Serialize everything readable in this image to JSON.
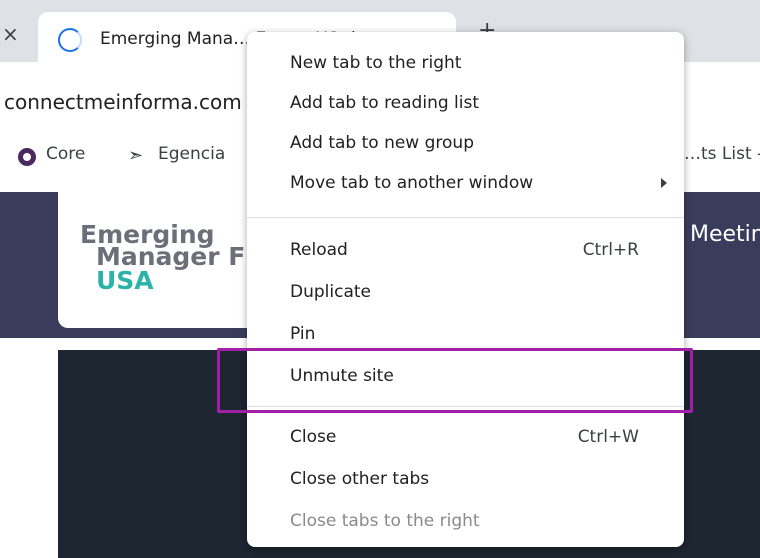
{
  "browser": {
    "tab": {
      "title": "Emerging Mana… EuropeUS.riv…"
    },
    "url": "connectmeinforma.com",
    "bookmarks": [
      {
        "label": "Core"
      },
      {
        "label": "Egencia"
      },
      {
        "label": "…ts List -…"
      }
    ]
  },
  "page": {
    "logo": {
      "line1": "Emerging",
      "line2": "Manager F",
      "line3": "USA"
    },
    "nav_item": "Meetin"
  },
  "context_menu": {
    "items": [
      {
        "label": "New tab to the right"
      },
      {
        "label": "Add tab to reading list"
      },
      {
        "label": "Add tab to new group"
      },
      {
        "label": "Move tab to another window"
      },
      {
        "label": "Reload",
        "shortcut": "Ctrl+R"
      },
      {
        "label": "Duplicate"
      },
      {
        "label": "Pin"
      },
      {
        "label": "Unmute site"
      },
      {
        "label": "Close",
        "shortcut": "Ctrl+W"
      },
      {
        "label": "Close other tabs"
      },
      {
        "label": "Close tabs to the right"
      }
    ]
  },
  "colors": {
    "highlight": "#a020a8",
    "header_bg": "#3a3c5c",
    "panel_bg": "#1d2631",
    "logo_accent": "#2bb3a8"
  }
}
